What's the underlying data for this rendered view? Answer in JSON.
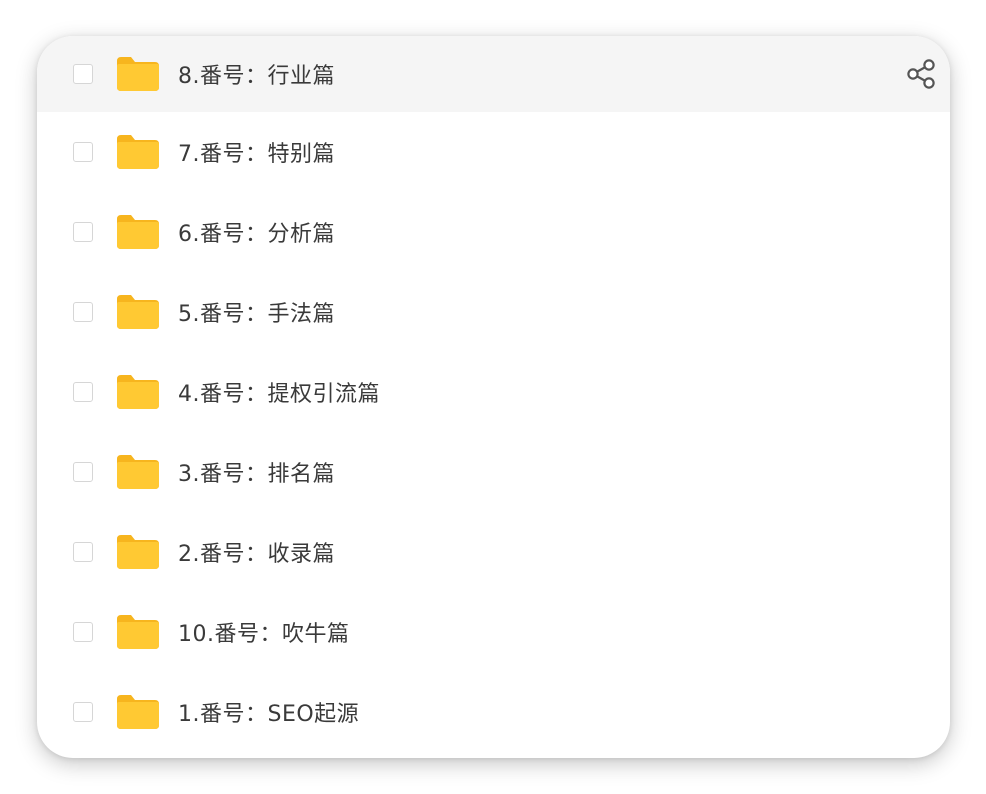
{
  "files": [
    {
      "name": "8.番号：行业篇",
      "selected": false
    },
    {
      "name": "7.番号：特别篇",
      "selected": false
    },
    {
      "name": "6.番号：分析篇",
      "selected": false
    },
    {
      "name": "5.番号：手法篇",
      "selected": false
    },
    {
      "name": "4.番号：提权引流篇",
      "selected": false
    },
    {
      "name": "3.番号：排名篇",
      "selected": false
    },
    {
      "name": "2.番号：收录篇",
      "selected": false
    },
    {
      "name": "10.番号：吹牛篇",
      "selected": false
    },
    {
      "name": "1.番号：SEO起源",
      "selected": false
    }
  ],
  "icons": {
    "folder": "folder-icon",
    "share": "share-icon"
  },
  "colors": {
    "folder": "#ffc933",
    "folder_tab": "#f7b51e",
    "highlight_row": "#f5f5f5",
    "checkbox_border": "#d6d6d6",
    "text": "#3a3a3a"
  }
}
